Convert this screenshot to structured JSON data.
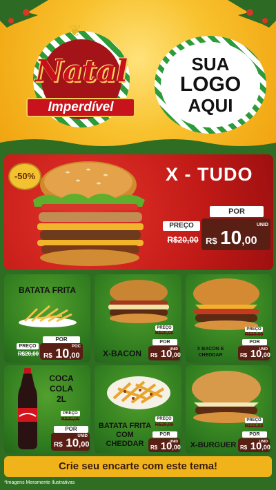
{
  "header": {
    "title_line1": "Natal",
    "title_line2": "Imperdível",
    "logo_lines": [
      "SUA",
      "LOGO",
      "AQUI"
    ]
  },
  "hero": {
    "discount": "-50%",
    "name": "X - TUDO",
    "preco_label": "PREÇO",
    "old_price": "R$20,00",
    "por_label": "POR",
    "currency": "R$",
    "price_int": "10",
    "price_cents": ",00",
    "unit": "UNID"
  },
  "products": [
    {
      "name": "BATATA FRITA",
      "preco_label": "PREÇO",
      "old_price": "R$20,00",
      "por_label": "POR",
      "currency": "R$",
      "price_int": "10",
      "price_cents": ",00",
      "unit": "POC"
    },
    {
      "name": "X-BACON",
      "preco_label": "PREÇO",
      "old_price": "R$20,00",
      "por_label": "POR",
      "currency": "R$",
      "price_int": "10",
      "price_cents": ",00",
      "unit": "UNID"
    },
    {
      "name": "X BACON E CHEDDAR",
      "preco_label": "PREÇO",
      "old_price": "R$20,00",
      "por_label": "POR",
      "currency": "R$",
      "price_int": "10",
      "price_cents": ",00",
      "unit": "UNID"
    },
    {
      "name": "COCA COLA 2L",
      "preco_label": "PREÇO",
      "old_price": "R$20,00",
      "por_label": "POR",
      "currency": "R$",
      "price_int": "10",
      "price_cents": ",00",
      "unit": "UNID"
    },
    {
      "name": "BATATA FRITA COM CHEDDAR",
      "preco_label": "PREÇO",
      "old_price": "R$20,00",
      "por_label": "POR",
      "currency": "R$",
      "price_int": "10",
      "price_cents": ",00",
      "unit": "UNID"
    },
    {
      "name": "X-BURGUER",
      "preco_label": "PREÇO",
      "old_price": "R$20,00",
      "por_label": "POR",
      "currency": "R$",
      "price_int": "10",
      "price_cents": ",00",
      "unit": "UNID"
    }
  ],
  "footer": {
    "cta": "Crie seu encarte com este tema!",
    "note": "*Imagens Meramente Ilustrativas"
  },
  "colors": {
    "gold": "#f5b816",
    "red": "#c11a17",
    "green": "#2f6d22",
    "price_bg": "#5a1f14"
  }
}
